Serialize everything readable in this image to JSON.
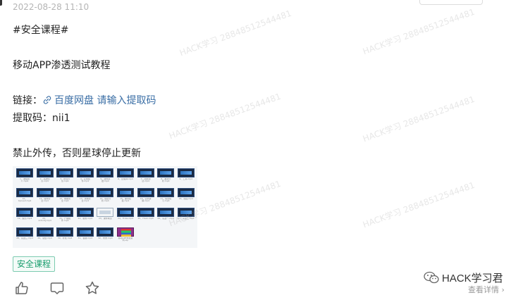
{
  "post": {
    "date": "2022-08-28 11:10",
    "hashtag": "#安全课程#",
    "title": "移动APP渗透测试教程",
    "link_label": "链接：",
    "link_text": "百度网盘 请输入提取码",
    "code_line": "提取码：nii1",
    "notice": "禁止外传，否则星球停止更新",
    "tag": "安全课程"
  },
  "footer": {
    "brand": "HACK学习君",
    "more": "查看详情"
  },
  "watermark": "HACK学习 28848512544481",
  "colors": {
    "link": "#3a6ea5",
    "tag_text": "#1a9e6e",
    "tag_border": "#7ccbb0"
  },
  "thumbnails": [
    "1、课程简介.mp4",
    "2、基础知识.mp4",
    "3、抓包环境.mp4",
    "4、应用组件.mp4",
    "5、逆向基础.mp4",
    "6、反编译.mp4",
    "7、动态调试.mp4",
    "8、漏洞分析.mp4",
    "9、工具.mp4",
    "10、Xposed.mp4",
    "11、组件安全.mp4",
    "12、数据安全.mp4",
    "13、通信安全.mp4",
    "14、加密分析.mp4",
    "15、漏洞挖掘.mp4",
    "16、实例讲解.mp4",
    "17、综合练习.mp4",
    "18、加固.mp4",
    "19、脱壳.mp4",
    "20、Activity.mp4",
    "21、广播组件.mp4",
    "22、服务.mp4",
    "23、课件网页",
    "24、Frida.mp4",
    "25、Hook.mp4",
    "26、实战一.mp4",
    "27、实战二.mp4",
    "28、实战三.mp4",
    "29、总结.mp4",
    "30、补充.mp4",
    "31、答疑.mp4",
    "32、附录.mp4",
    "移动APP渗透资料.zip"
  ]
}
